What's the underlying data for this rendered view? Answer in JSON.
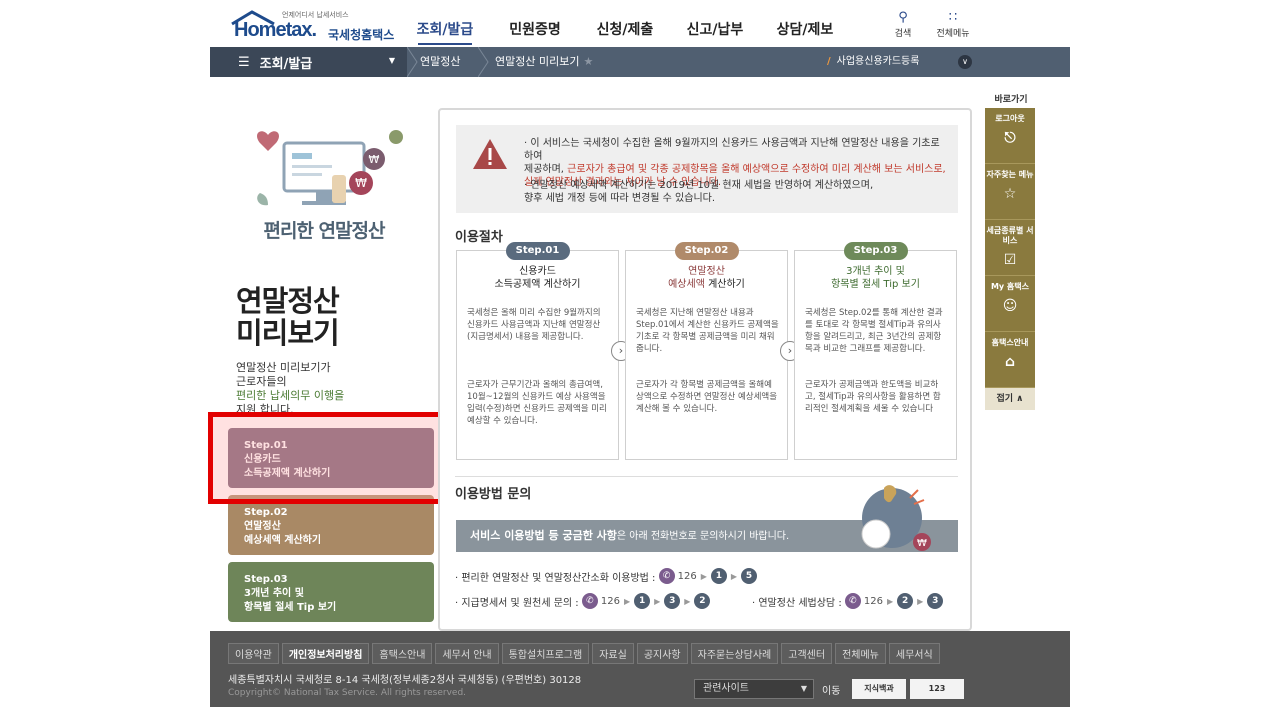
{
  "header": {
    "logo_tag": "언제어디서 납세서비스",
    "logo_word": "Hometax.",
    "logo_kr": "국세청홈택스",
    "gnb": [
      "조회/발급",
      "민원증명",
      "신청/제출",
      "신고/납부",
      "상담/제보"
    ],
    "search_label": "검색",
    "allmenu_label": "전체메뉴"
  },
  "lnb": {
    "menu": "조회/발급",
    "crumb1": "연말정산",
    "crumb2": "연말정산 미리보기",
    "card_link": "사업용신용카드등록"
  },
  "left": {
    "convenient": "편리한 연말정산",
    "title_line1": "연말정산",
    "title_line2": "미리보기",
    "desc1": "연말정산 미리보기가",
    "desc2": "근로자들의",
    "desc3": "편리한 납세의무 이행을",
    "desc4": "지원 합니다.",
    "steps": [
      {
        "num": "Step.01",
        "l1": "신용카드",
        "l2": "소득공제액 계산하기",
        "color": "#755e74"
      },
      {
        "num": "Step.02",
        "l1": "연말정산",
        "l2": "예상세액 계산하기",
        "color": "#a98965"
      },
      {
        "num": "Step.03",
        "l1": "3개년 추이 및",
        "l2": "항목별 절세 Tip 보기",
        "color": "#6e8559"
      }
    ]
  },
  "notice": {
    "p1a": "· 이 서비스는 국세청이 수집한 올해 9월까지의 신용카드 사용금액과 지난해 연말정산 내용을 기초로 하여",
    "p1b": "제공하며, ",
    "p1c": "근로자가 총급여 및 각종 공제항목을 올해 예상액으로 수정하여 미리 계산해 보는 서비스로,",
    "p1d": "실제 연말정산 결과와는 차이가 날 수 있습니다.",
    "p2a": "· 연말정산 예상세액 계산하기는 2019년 10월 현재 세법을 반영하여 계산하였으며,",
    "p2b": "향후 세법 개정 등에 따라 변경될 수 있습니다."
  },
  "procedure": {
    "title": "이용절차",
    "steps": [
      {
        "badge": "Step.01",
        "color": "#5a6b7e",
        "t1": "신용카드",
        "t2": "소득공제액 계산하기",
        "p1": "국세청은 올해 미리 수집한 9월까지의 신용카드 사용금액과 지난해 연말정산(지급명세서) 내용을 제공합니다.",
        "p2": "근로자가 근무기간과 올해의 총급여액, 10월~12월의 신용카드 예상 사용액을 입력(수정)하면 신용카드 공제액을 미리 예상할 수 있습니다."
      },
      {
        "badge": "Step.02",
        "color": "#b08a6a",
        "t1": "연말정산",
        "t2": "예상세액",
        "t3": " 계산하기",
        "p1": "국세청은 지난해 연말정산 내용과 Step.01에서 계산한 신용카드 공제액을 기초로 각 항목별 공제금액을 미리 채워줍니다.",
        "p2": "근로자가 각 항목별 공제금액을 올해예상액으로 수정하면 연말정산 예상세액을 계산해 볼 수 있습니다."
      },
      {
        "badge": "Step.03",
        "color": "#6e8a5a",
        "t1": "3개년 추이 및",
        "t2": "항목별 절세 Tip 보기",
        "p1": "국세청은 Step.02를 통해 계산한 결과를 토대로 각 항목별 절세Tip과 유의사항을 알려드리고, 최근 3년간의 공제항목과 비교한 그래프를 제공합니다.",
        "p2": "근로자가 공제금액과 한도액을 비교하고, 절세Tip과 유의사항을 활용하면 합리적인 절세계획을 세울 수 있습니다"
      }
    ]
  },
  "inquiry": {
    "title": "이용방법 문의",
    "banner_bold": "서비스 이용방법 등 궁금한 사항",
    "banner_rest": "은 아래 전화번호로 문의하시기 바랍니다.",
    "line1_label": "· 편리한 연말정산 및 연말정산간소화 이용방법 :",
    "line2_label": "· 지급명세서 및 원천세 문의 :",
    "line3_label": "· 연말정산 세법상담 :",
    "phone": "126",
    "n1": "1",
    "n2": "2",
    "n3": "3",
    "n5": "5"
  },
  "quick": {
    "title": "바로가기",
    "items": [
      "로그아웃",
      "자주찾는 메뉴",
      "세금종류별 서비스",
      "My 홈택스",
      "홈택스안내"
    ],
    "close": "접기"
  },
  "footer": {
    "links": [
      "이용약관",
      "개인정보처리방침",
      "홈택스안내",
      "세무서 안내",
      "통합설치프로그램",
      "자료실",
      "공지사항",
      "자주묻는상담사례",
      "고객센터",
      "전체메뉴",
      "세무서식"
    ],
    "address": "세종특별자치시 국세청로 8-14 국세청(정부세종2청사 국세청동) (우편번호) 30128",
    "copyright": "Copyright© National Tax Service. All rights reserved.",
    "related": "관련사이트",
    "go": "이동",
    "badge1": "지식백과",
    "badge2": "123"
  }
}
